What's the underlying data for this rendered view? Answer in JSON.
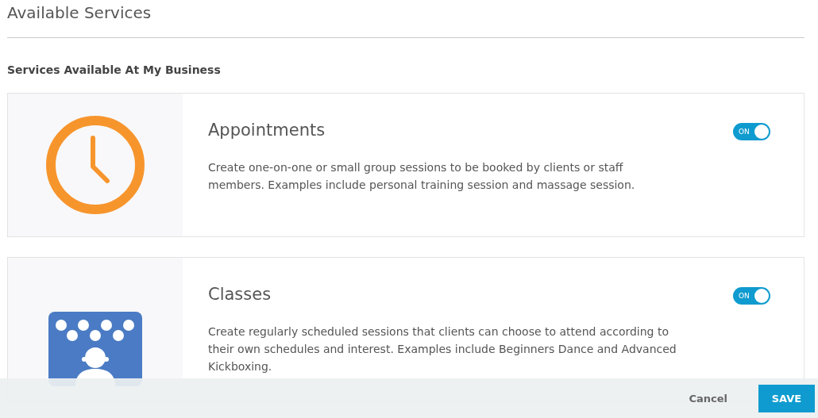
{
  "title": "Available Services",
  "section_heading": "Services Available At My Business",
  "services": [
    {
      "kind": "clock",
      "name": "Appointments",
      "on": true,
      "toggle_label": "ON",
      "description": "Create one-on-one or small group sessions to be booked by clients or staff members. Examples include personal training session and massage session."
    },
    {
      "kind": "class",
      "name": "Classes",
      "on": true,
      "toggle_label": "ON",
      "description": "Create regularly scheduled sessions that clients can choose to attend according to their own schedules and interest. Examples include Beginners Dance and Advanced Kickboxing."
    }
  ],
  "footer": {
    "cancel": "Cancel",
    "save": "SAVE"
  }
}
